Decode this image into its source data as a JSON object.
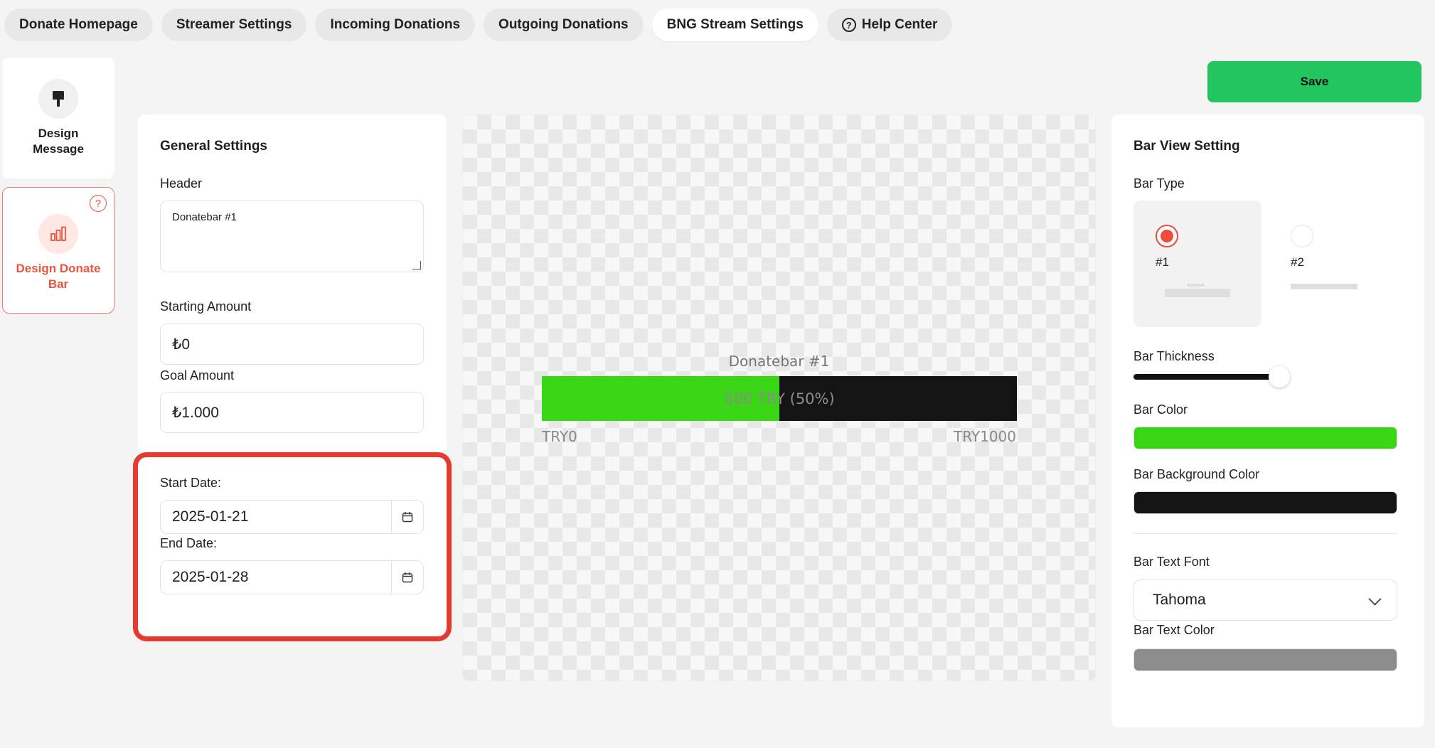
{
  "tabs": [
    {
      "label": "Donate Homepage",
      "active": false
    },
    {
      "label": "Streamer Settings",
      "active": false
    },
    {
      "label": "Incoming Donations",
      "active": false
    },
    {
      "label": "Outgoing Donations",
      "active": false
    },
    {
      "label": "BNG Stream Settings",
      "active": true
    },
    {
      "label": "Help Center",
      "active": false,
      "icon": "question-circle-icon"
    }
  ],
  "sidebar": {
    "items": [
      {
        "label": "Design Message",
        "icon": "paint-roller-icon",
        "active": false
      },
      {
        "label": "Design Donate Bar",
        "icon": "bar-chart-icon",
        "active": true,
        "help": "?"
      }
    ]
  },
  "toolbar": {
    "save_label": "Save"
  },
  "general": {
    "title": "General Settings",
    "header_label": "Header",
    "header_value": "Donatebar #1",
    "starting_amount_label": "Starting Amount",
    "starting_amount_value": "₺0",
    "goal_amount_label": "Goal Amount",
    "goal_amount_value": "₺1.000",
    "start_date_label": "Start Date:",
    "start_date_value": "2025-01-21",
    "end_date_label": "End Date:",
    "end_date_value": "2025-01-28"
  },
  "preview": {
    "header": "Donatebar #1",
    "progress": 0.5,
    "bar_text": "500 TRY (50%)",
    "min_label": "TRY0",
    "max_label": "TRY1000"
  },
  "bar_view": {
    "title": "Bar View Setting",
    "bar_type_label": "Bar Type",
    "bar_types": [
      {
        "label": "#1",
        "selected": true
      },
      {
        "label": "#2",
        "selected": false
      }
    ],
    "thickness_label": "Bar Thickness",
    "thickness_level": 0.55,
    "bar_color_label": "Bar Color",
    "bar_color": "#3ad615",
    "bar_bg_color_label": "Bar Background Color",
    "bar_bg_color": "#141414",
    "bar_text_font_label": "Bar Text Font",
    "bar_text_font_value": "Tahoma",
    "bar_text_color_label": "Bar Text Color",
    "bar_text_color": "#8c8c8c"
  },
  "colors": {
    "accent": "#e9553d",
    "save": "#22c55e",
    "highlight_box": "#e43a2f"
  }
}
